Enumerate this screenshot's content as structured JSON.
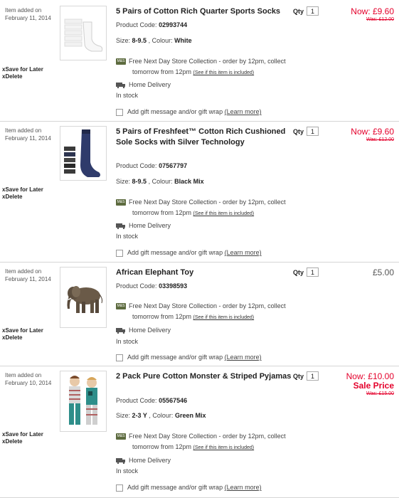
{
  "common": {
    "qty_label": "Qty",
    "collection_line1": "Free Next Day Store Collection - order by 12pm, collect",
    "collection_line2": "tomorrow from 12pm",
    "collection_link": "(See if this item is included)",
    "home_delivery": "Home Delivery",
    "in_stock": "In stock",
    "gift_text": "Add gift message and/or gift wrap",
    "learn_more": "(Learn more)",
    "save_for_later": "Save for Later",
    "delete": "Delete",
    "item_added_on": "Item added on",
    "product_code_label": "Product Code:",
    "size_label": "Size:",
    "colour_label": ", Colour:",
    "collection_icon": "M&S",
    "accent_color": "#e4002b"
  },
  "items": [
    {
      "date": "February 11, 2014",
      "title": "5 Pairs of Cotton Rich Quarter Sports Socks",
      "code": "02993744",
      "size": "8-9.5",
      "colour": "White",
      "qty": "1",
      "price_now": "Now: £9.60",
      "price_was": "Was: £12.00",
      "image": "white-socks-image"
    },
    {
      "date": "February 11, 2014",
      "title": "5 Pairs of Freshfeet™ Cotton Rich Cushioned Sole Socks with Silver Technology",
      "code": "07567797",
      "size": "8-9.5",
      "colour": "Black Mix",
      "qty": "1",
      "price_now": "Now: £9.60",
      "price_was": "Was: £12.00",
      "image": "dark-socks-image"
    },
    {
      "date": "February 11, 2014",
      "title": "African Elephant Toy",
      "code": "03398593",
      "qty": "1",
      "price": "£5.00",
      "image": "elephant-toy-image"
    },
    {
      "date": "February 10, 2014",
      "title": "2 Pack Pure Cotton Monster & Striped Pyjamas",
      "code": "05567546",
      "size": "2-3 Y",
      "colour": "Green Mix",
      "qty": "1",
      "price_now": "Now: £10.00",
      "sale_label": "Sale Price",
      "price_was": "Was: £15.00",
      "image": "pyjamas-image"
    }
  ]
}
